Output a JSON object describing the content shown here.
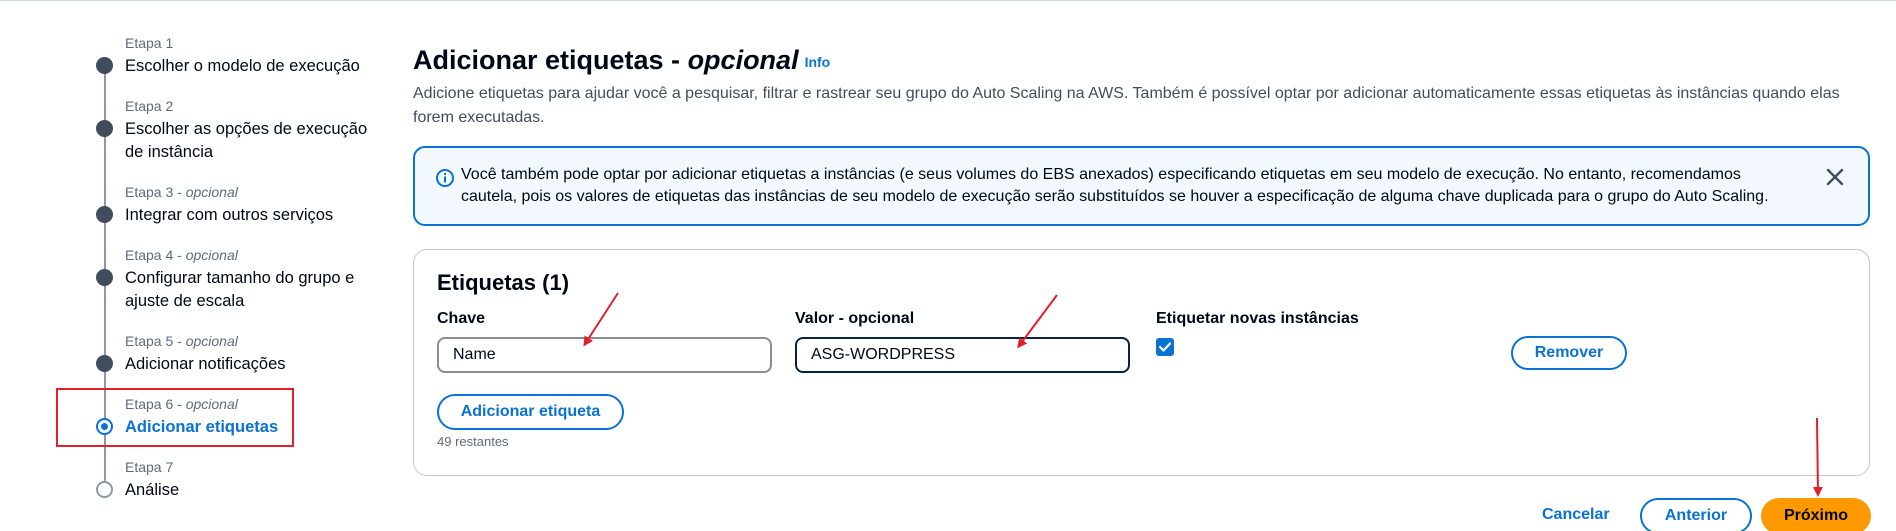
{
  "steps": [
    {
      "label": "Etapa 1",
      "optional": "",
      "title": "Escolher o modelo de execução",
      "state": "done"
    },
    {
      "label": "Etapa 2",
      "optional": "",
      "title": "Escolher as opções de execução de instância",
      "state": "done"
    },
    {
      "label": "Etapa 3 - ",
      "optional": "opcional",
      "title": "Integrar com outros serviços",
      "state": "done"
    },
    {
      "label": "Etapa 4 - ",
      "optional": "opcional",
      "title": "Configurar tamanho do grupo e ajuste de escala",
      "state": "done"
    },
    {
      "label": "Etapa 5 - ",
      "optional": "opcional",
      "title": "Adicionar notificações",
      "state": "done"
    },
    {
      "label": "Etapa 6 - ",
      "optional": "opcional",
      "title": "Adicionar etiquetas",
      "state": "active"
    },
    {
      "label": "Etapa 7",
      "optional": "",
      "title": "Análise",
      "state": "pending"
    }
  ],
  "header": {
    "title": "Adicionar etiquetas - ",
    "title_optional": "opcional",
    "info_link": "Info",
    "description": "Adicione etiquetas para ajudar você a pesquisar, filtrar e rastrear seu grupo do Auto Scaling na AWS. Também é possível optar por adicionar automaticamente essas etiquetas às instâncias quando elas forem executadas."
  },
  "alert": {
    "text": "Você também pode optar por adicionar etiquetas a instâncias (e seus volumes do EBS anexados) especificando etiquetas em seu modelo de execução. No entanto, recomendamos cautela, pois os valores de etiquetas das instâncias de seu modelo de execução serão substituídos se houver a especificação de alguma chave duplicada para o grupo do Auto Scaling."
  },
  "tags": {
    "title": "Etiquetas (1)",
    "key_label": "Chave",
    "value_label": "Valor - opcional",
    "tag_new_label": "Etiquetar novas instâncias",
    "rows": [
      {
        "key": "Name",
        "value": "ASG-WORDPRESS",
        "tag_new_instances": true
      }
    ],
    "remove_label": "Remover",
    "add_label": "Adicionar etiqueta",
    "remaining": "49 restantes"
  },
  "footer": {
    "cancel": "Cancelar",
    "previous": "Anterior",
    "next": "Próximo"
  },
  "colors": {
    "accent": "#0972d3",
    "primary_button": "#ff9900",
    "annotation": "#e0202a"
  }
}
